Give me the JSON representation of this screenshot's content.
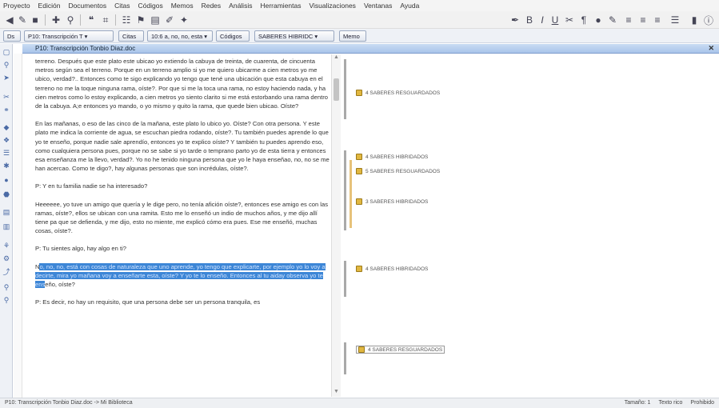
{
  "menubar": {
    "items": [
      "Proyecto",
      "Edición",
      "Documentos",
      "Citas",
      "Códigos",
      "Memos",
      "Redes",
      "Análisis",
      "Herramientas",
      "Visualizaciones",
      "Ventanas",
      "Ayuda"
    ]
  },
  "toolbar2": {
    "btn1": "Ds",
    "doc_select": "P10: Transcripción T ▾",
    "btn_citas": "Citas",
    "cita_select": "10:6 a, no, no, esta ▾",
    "btn_codigos": "Códigos",
    "code_select": "SABERES HIBRIDC ▾",
    "btn_memos": "Memo"
  },
  "doc": {
    "title": "P10: Transcripción Tonbio Diaz.doc",
    "paragraphs": [
      "terreno. Después que este plato este ubicao yo extiendo la cabuya de treinta, de cuarenta, de cincuenta metros según sea el terreno. Porque en un terreno amplio si yo me quiero ubicarme a cien metros yo me ubico, verdad?.. Entonces como te sigo explicando yo tengo que tené una ubicación que esta cabuya en el terreno no me la toque ninguna rama, oíste?. Por que si me la toca una rama, no estoy haciendo nada, y ha cien metros como lo estoy explicando, a cien metros yo siento clarito si me está estorbando una rama dentro de la cabuya. A;e entonces yo mando, o yo mismo y quito la rama, que quede bien ubicao. Oíste?",
      "En las mañanas, o eso de las cinco de la mañana, este plato lo ubico yo. Oíste? Con otra persona. Y este plato me indica la corriente de agua, se escuchan piedra rodando, oíste?. Tu también puedes aprende lo que yo te enseño, porque nadie sale aprendío, entonces yo te explico oíste? Y también tu puedes aprendo eso, como cualquiera persona pues, porque no se sabe si yo tarde o temprano parto yo de esta tierra y entonces esa enseñanza me la llevo, verdad?. Yo no he tenido ninguna persona que yo le haya enseñao, no, no se me han acercao. Como te digo?, hay algunas personas que son incrédulas, oíste?.",
      "P: Y en tu familia nadie se ha interesado?",
      "Heeeeee, yo tuve un amigo que quería y le dige pero, no tenía afición oíste?, entonces ese amigo es con las ramas, oíste?, ellos se ubican con una ramita. Esto me lo enseñó un indio de muchos años, y me dijo allí tiene pa que se defienda, y me dijo, esto no miente, me explicó cómo era pues. Ese me enseñó, muchas cosas, oíste?.",
      "P: Tu sientes algo, hay algo en ti?"
    ],
    "highlight_prefix": "N",
    "highlight_text": "o, no, no, está con cosas de naturaleza que uno aprende, yo tengo que explicarte, por ejemplo yo lo voy a decirte, mira yo mañana voy a enseñarte esta, oíste? Y yo te lo enseño. Entonces al tu aiday observa yo te ens",
    "highlight_suffix": "eño, oíste?",
    "last_paragraph": "P: Es decir, no hay un requisito, que una persona debe ser un persona tranquila, es"
  },
  "margin_codes": [
    "4 SABERES RESGUARDADOS",
    "4 SABERES HIBRIDADOS",
    "5 SABERES RESGUARDADOS",
    "3 SABERES HIBRIDADOS",
    "4 SABERES HIBRIDADOS",
    "4 SABERES RESGUARDADOS"
  ],
  "colors": {
    "selection": "#3d86d6",
    "margin_bar_gray": "#a9a9a9",
    "margin_bar_gold": "#e7c27a",
    "code_icon": "#e1b740"
  },
  "status": {
    "left": "P10: Transcripción Tonbio Diaz.doc -> Mi Biblioteca",
    "right_size": "Tamaño: 1",
    "right_text": "Texto rico",
    "right_state": "Prohibido"
  }
}
